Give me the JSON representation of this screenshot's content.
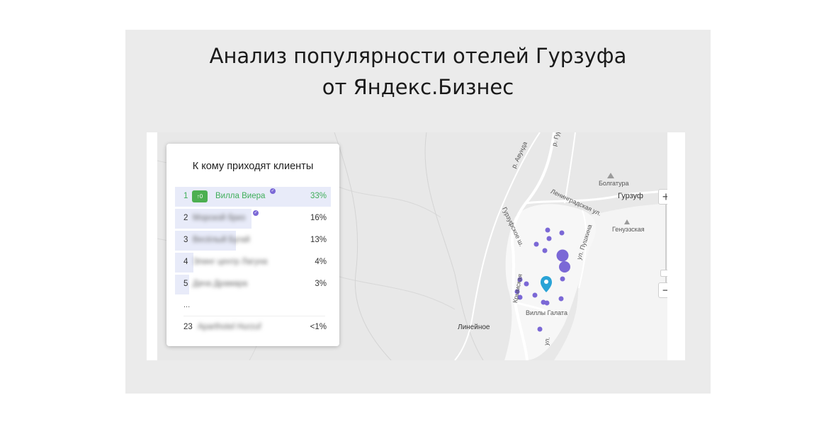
{
  "slide": {
    "title_line1": "Анализ популярности отелей Гурзуфа",
    "title_line2": "от Яндекс.Бизнес"
  },
  "panel": {
    "title": "К кому приходят клиенты",
    "rows": [
      {
        "rank": "1",
        "badge": "↑0",
        "name": "Вилла Виера",
        "share": "33%",
        "share_value": 33,
        "verified": true
      },
      {
        "rank": "2",
        "name": "Морской бриз",
        "share": "16%",
        "share_value": 16,
        "verified": true,
        "blurred": true
      },
      {
        "rank": "3",
        "name": "Весёлый Бугай",
        "share": "13%",
        "share_value": 13,
        "blurred": true
      },
      {
        "rank": "4",
        "name": "Элинг центр Лагуна",
        "share": "4%",
        "share_value": 4,
        "blurred": true
      },
      {
        "rank": "5",
        "name": "Дача Драмара",
        "share": "3%",
        "share_value": 3,
        "blurred": true
      },
      {
        "rank": "23",
        "name": "Aparthotel Hurzuf",
        "share": "<1%",
        "share_value": 0.5,
        "blurred": true
      }
    ],
    "ellipsis": "..."
  },
  "map": {
    "labels": {
      "gurzuf": "Гурзуф",
      "bolgatura": "Болгатура",
      "leningradskaya": "Ленинградская ул.",
      "genuezskaya": "Генуэзская",
      "villy_galata": "Виллы Галата",
      "lineynoe": "Линейное",
      "gurzufskoe": "Гурзуфское ш.",
      "avunda": "р. Авунда",
      "gurzuf_river": "р. Гурзуф",
      "pushkina": "ул. Пушкина",
      "krymskaya": "Крымская",
      "road_ul": "ул."
    },
    "zoom_in": "+",
    "zoom_out": "−",
    "accent_color": "#7b68d6",
    "pin_color": "#29a3d6"
  }
}
